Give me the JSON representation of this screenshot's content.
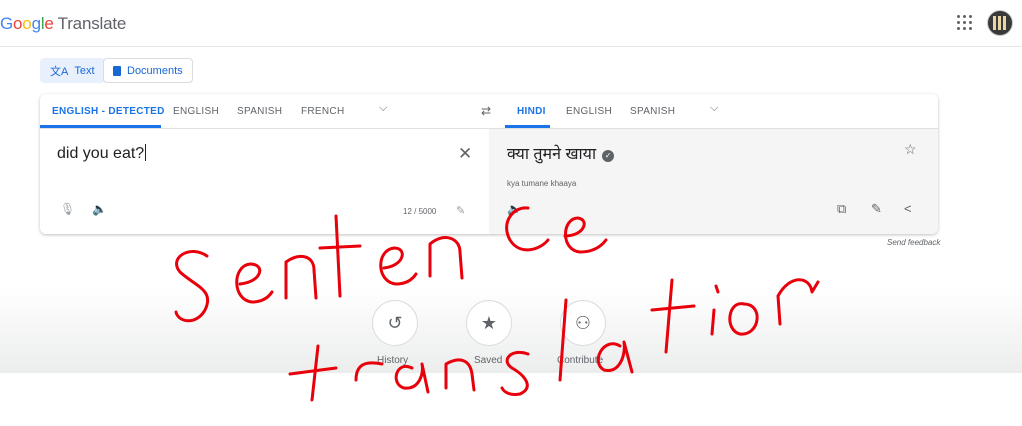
{
  "app": {
    "logo_google": [
      "G",
      "o",
      "o",
      "g",
      "l",
      "e"
    ],
    "logo_product": "Translate"
  },
  "modes": [
    {
      "label": "Text",
      "icon": "translate-icon",
      "active": true
    },
    {
      "label": "Documents",
      "icon": "document-icon",
      "active": false
    }
  ],
  "source_langs": [
    "ENGLISH - DETECTED",
    "ENGLISH",
    "SPANISH",
    "FRENCH"
  ],
  "target_langs": [
    "HINDI",
    "ENGLISH",
    "SPANISH"
  ],
  "source": {
    "text": "did you eat?",
    "char_count": "12 / 5000"
  },
  "target": {
    "text": "क्या तुमने खाया",
    "transliteration": "kya tumane khaaya"
  },
  "feedback": "Send feedback",
  "bottom": [
    {
      "label": "History",
      "icon": "history-icon"
    },
    {
      "label": "Saved",
      "icon": "star-icon"
    },
    {
      "label": "Contribute",
      "icon": "contribute-icon"
    }
  ],
  "annotation": "sentence translation",
  "colors": {
    "accent": "#1a73e8",
    "ink": "#e8000b"
  }
}
